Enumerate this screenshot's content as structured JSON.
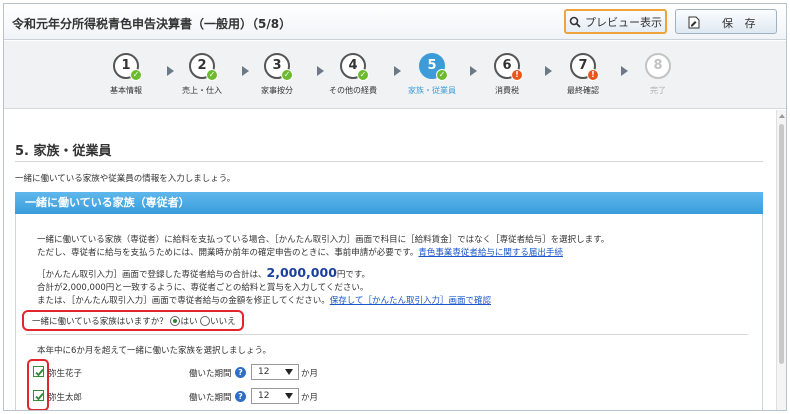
{
  "header": {
    "title": "令和元年分所得税青色申告決算書（一般用）（5/8）",
    "preview_label": "プレビュー表示",
    "save_label": "保 存"
  },
  "steps": [
    {
      "number": "1",
      "label": "基本情報",
      "status": "done"
    },
    {
      "number": "2",
      "label": "売上・仕入",
      "status": "done"
    },
    {
      "number": "3",
      "label": "家事按分",
      "status": "done"
    },
    {
      "number": "4",
      "label": "その他の経費",
      "status": "done"
    },
    {
      "number": "5",
      "label": "家族・従業員",
      "status": "current"
    },
    {
      "number": "6",
      "label": "消費税",
      "status": "warning"
    },
    {
      "number": "7",
      "label": "最終確認",
      "status": "warning"
    },
    {
      "number": "8",
      "label": "完了",
      "status": "inactive"
    }
  ],
  "section": {
    "title": "5. 家族・従業員",
    "intro": "一緒に働いている家族や従業員の情報を入力しましょう。"
  },
  "panel": {
    "title": "一緒に働いている家族（専従者）",
    "line1": "一緒に働いている家族（専従者）に給料を支払っている場合、［かんたん取引入力］画面で科目に［給料賃金］ではなく［専従者給与］を選択します。",
    "line2": "ただし、専従者に給与を支払うためには、開業時か前年の確定申告のときに、事前申請が必要です。",
    "line2_link": "青色事業専従者給与に関する届出手続",
    "line3_pre": "［かんたん取引入力］画面で登録した専従者給与の合計は、",
    "line3_amount": "2,000,000",
    "line3_post": "円です。",
    "line4": "合計が2,000,000円と一致するように、専従者ごとの給料と賞与を入力してください。",
    "line5": "または、［かんたん取引入力］画面で専従者給与の金額を修正してください。",
    "line5_link": "保存して［かんたん取引入力］画面で確認",
    "question": "一緒に働いている家族はいますか？",
    "yes_label": "はい",
    "no_label": "いいえ",
    "selected": "yes",
    "select_prompt": "本年中に6か月を超えて一緒に働いた家族を選択しましょう。",
    "period_label": "働いた期間",
    "months_unit": "か月",
    "family": [
      {
        "name": "弥生花子",
        "checked": true,
        "months": "12"
      },
      {
        "name": "弥生太郎",
        "checked": true,
        "months": "12"
      }
    ]
  },
  "colors": {
    "accent": "#3d9cd8",
    "done_badge": "#6cbb2e",
    "warning_badge": "#e8551e",
    "highlight_border": "#e3262d",
    "preview_border": "#f0a23c",
    "link": "#1a56c8"
  },
  "icons": {
    "preview": "magnifier-icon",
    "save": "save-document-icon",
    "done": "check-icon",
    "warning": "exclamation-icon",
    "help": "question-icon"
  }
}
